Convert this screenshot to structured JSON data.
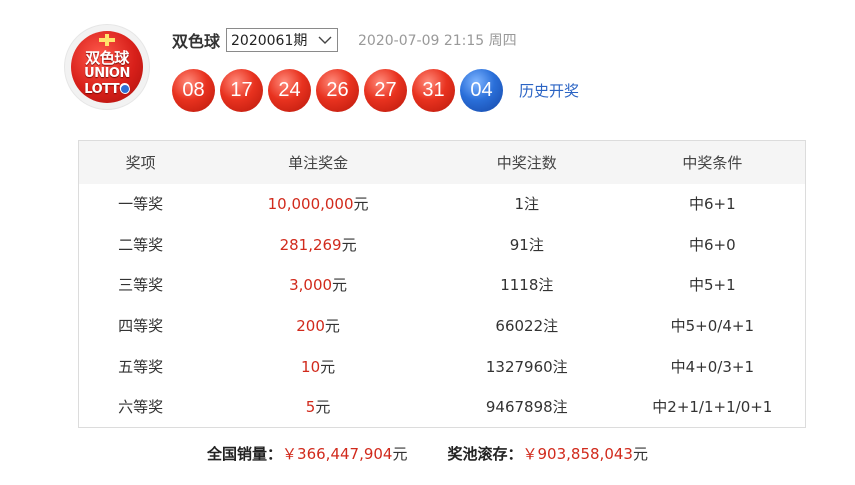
{
  "header": {
    "logo": {
      "line1": "双色球",
      "line2": "UNION",
      "line3": "LOTTO"
    },
    "game_name": "双色球",
    "issue_value": "2020061期",
    "draw_datetime": "2020-07-09 21:15 周四",
    "balls": {
      "red": [
        "08",
        "17",
        "24",
        "26",
        "27",
        "31"
      ],
      "blue": "04"
    },
    "history_link": "历史开奖",
    "colors": {
      "red_ball": "#e8321f",
      "blue_ball": "#2a6fd9",
      "link": "#2b64c4",
      "amount": "#d12a1c"
    }
  },
  "table": {
    "headers": [
      "奖项",
      "单注奖金",
      "中奖注数",
      "中奖条件"
    ],
    "rows": [
      {
        "level": "一等奖",
        "amount": "10,000,000",
        "unit": "元",
        "count": "1注",
        "condition": "中6+1"
      },
      {
        "level": "二等奖",
        "amount": "281,269",
        "unit": "元",
        "count": "91注",
        "condition": "中6+0"
      },
      {
        "level": "三等奖",
        "amount": "3,000",
        "unit": "元",
        "count": "1118注",
        "condition": "中5+1"
      },
      {
        "level": "四等奖",
        "amount": "200",
        "unit": "元",
        "count": "66022注",
        "condition": "中5+0/4+1"
      },
      {
        "level": "五等奖",
        "amount": "10",
        "unit": "元",
        "count": "1327960注",
        "condition": "中4+0/3+1"
      },
      {
        "level": "六等奖",
        "amount": "5",
        "unit": "元",
        "count": "9467898注",
        "condition": "中2+1/1+1/0+1"
      }
    ]
  },
  "summary": {
    "sales_label": "全国销量：",
    "sales_value": "￥366,447,904",
    "sales_unit": "元",
    "pool_label": "奖池滚存：",
    "pool_value": "￥903,858,043",
    "pool_unit": "元"
  }
}
